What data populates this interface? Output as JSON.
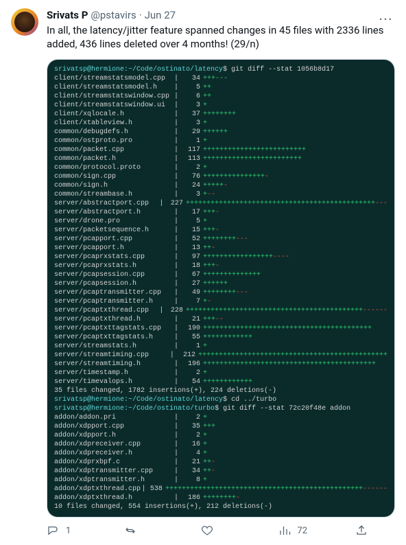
{
  "author": {
    "display_name": "Srivats P",
    "handle": "@pstavirs",
    "dot": "·",
    "date": "Jun 27"
  },
  "more_label": "···",
  "tweet_text": "In all, the latency/jitter feature spanned changes in 45 files with 2336 lines added, 436 lines deleted over 4 months! (29/n)",
  "terminal": {
    "prompt1_user": "srivatsp@hermione",
    "prompt1_path": ":~/Code/ostinato/latency",
    "prompt1_dollar": "$ ",
    "cmd1": "git diff --stat 1056b8d17",
    "files1": [
      {
        "name": " client/streamstatsmodel.cpp",
        "num": 34,
        "plus": "+++---",
        "minus": ""
      },
      {
        "name": " client/streamstatsmodel.h",
        "num": 5,
        "plus": "++",
        "minus": ""
      },
      {
        "name": " client/streamstatswindow.cpp",
        "num": 6,
        "plus": "++",
        "minus": ""
      },
      {
        "name": " client/streamstatswindow.ui",
        "num": 3,
        "plus": "+",
        "minus": ""
      },
      {
        "name": " client/xqlocale.h",
        "num": 37,
        "plus": "++++++++",
        "minus": ""
      },
      {
        "name": " client/xtableview.h",
        "num": 3,
        "plus": "+",
        "minus": ""
      },
      {
        "name": " common/debugdefs.h",
        "num": 29,
        "plus": "++++++",
        "minus": ""
      },
      {
        "name": " common/ostproto.pro",
        "num": 1,
        "plus": "+",
        "minus": ""
      },
      {
        "name": " common/packet.cpp",
        "num": 117,
        "plus": "+++++++++++++++++++++++++",
        "minus": ""
      },
      {
        "name": " common/packet.h",
        "num": 113,
        "plus": "++++++++++++++++++++++++",
        "minus": ""
      },
      {
        "name": " common/protocol.proto",
        "num": 2,
        "plus": "+",
        "minus": ""
      },
      {
        "name": " common/sign.cpp",
        "num": 76,
        "plus": "+++++++++++++++",
        "minus": "-"
      },
      {
        "name": " common/sign.h",
        "num": 24,
        "plus": "+++++",
        "minus": "-"
      },
      {
        "name": " common/streambase.h",
        "num": 3,
        "plus": "+",
        "minus": "--"
      },
      {
        "name": " server/abstractport.cpp",
        "num": 227,
        "plus": "++++++++++++++++++++++++++++++++++++++++++++++",
        "minus": "---"
      },
      {
        "name": " server/abstractport.h",
        "num": 17,
        "plus": "+++",
        "minus": "-"
      },
      {
        "name": " server/drone.pro",
        "num": 5,
        "plus": "+",
        "minus": ""
      },
      {
        "name": " server/packetsequence.h",
        "num": 15,
        "plus": "+++",
        "minus": "-"
      },
      {
        "name": " server/pcapport.cpp",
        "num": 52,
        "plus": "++++++++",
        "minus": "---"
      },
      {
        "name": " server/pcapport.h",
        "num": 13,
        "plus": "++",
        "minus": "-"
      },
      {
        "name": " server/pcaprxstats.cpp",
        "num": 97,
        "plus": "+++++++++++++++++",
        "minus": "----"
      },
      {
        "name": " server/pcaprxstats.h",
        "num": 18,
        "plus": "+++",
        "minus": "-"
      },
      {
        "name": " server/pcapsession.cpp",
        "num": 67,
        "plus": "++++++++++++++",
        "minus": ""
      },
      {
        "name": " server/pcapsession.h",
        "num": 27,
        "plus": "++++++",
        "minus": ""
      },
      {
        "name": " server/pcaptransmitter.cpp",
        "num": 49,
        "plus": "++++++++",
        "minus": "---"
      },
      {
        "name": " server/pcaptransmitter.h",
        "num": 7,
        "plus": "+",
        "minus": "-"
      },
      {
        "name": " server/pcaptxthread.cpp",
        "num": 228,
        "plus": "+++++++++++++++++++++++++++++++++++++++++++",
        "minus": "------"
      },
      {
        "name": " server/pcaptxthread.h",
        "num": 21,
        "plus": "+++",
        "minus": "--"
      },
      {
        "name": " server/pcaptxttagstats.cpp",
        "num": 190,
        "plus": "+++++++++++++++++++++++++++++++++++++++++",
        "minus": ""
      },
      {
        "name": " server/pcaptxttagstats.h",
        "num": 55,
        "plus": "++++++++++++",
        "minus": ""
      },
      {
        "name": " server/streamstats.h",
        "num": 1,
        "plus": "+",
        "minus": ""
      },
      {
        "name": " server/streamtiming.cpp",
        "num": 212,
        "plus": "++++++++++++++++++++++++++++++++++++++++++++++",
        "minus": ""
      },
      {
        "name": " server/streamtiming.h",
        "num": 196,
        "plus": "++++++++++++++++++++++++++++++++++++++++++",
        "minus": ""
      },
      {
        "name": " server/timestamp.h",
        "num": 2,
        "plus": "+",
        "minus": ""
      },
      {
        "name": " server/timevalops.h",
        "num": 54,
        "plus": "++++++++++++",
        "minus": ""
      }
    ],
    "summary1": " 35 files changed, 1782 insertions(+), 224 deletions(-)",
    "prompt2_path": ":~/Code/ostinato/latency",
    "cmd2": "cd ../turbo",
    "prompt3_path": ":~/Code/ostinato/turbo",
    "cmd3": "git diff --stat 72c20f48e addon",
    "files2": [
      {
        "name": " addon/addon.pri",
        "num": 2,
        "plus": "+",
        "minus": ""
      },
      {
        "name": " addon/xdpport.cpp",
        "num": 35,
        "plus": "+++",
        "minus": ""
      },
      {
        "name": " addon/xdpport.h",
        "num": 2,
        "plus": "+",
        "minus": ""
      },
      {
        "name": " addon/xdpreceiver.cpp",
        "num": 16,
        "plus": "+",
        "minus": ""
      },
      {
        "name": " addon/xdpreceiver.h",
        "num": 4,
        "plus": "+",
        "minus": ""
      },
      {
        "name": " addon/xdprxbpf.c",
        "num": 21,
        "plus": "++",
        "minus": "-"
      },
      {
        "name": " addon/xdptransmitter.cpp",
        "num": 34,
        "plus": "++",
        "minus": "-"
      },
      {
        "name": " addon/xdptransmitter.h",
        "num": 8,
        "plus": "+",
        "minus": ""
      },
      {
        "name": " addon/xdptxthread.cpp",
        "num": 538,
        "plus": "++++++++++++++++++++++++++++++++++++++++++++++++",
        "minus": "------"
      },
      {
        "name": " addon/xdptxthread.h",
        "num": 186,
        "plus": "++++++++",
        "minus": "-"
      }
    ],
    "summary2": " 10 files changed, 554 insertions(+), 212 deletions(-)"
  },
  "actions": {
    "reply_count": "1",
    "retweet_count": "",
    "like_count": "",
    "view_count": "72"
  }
}
